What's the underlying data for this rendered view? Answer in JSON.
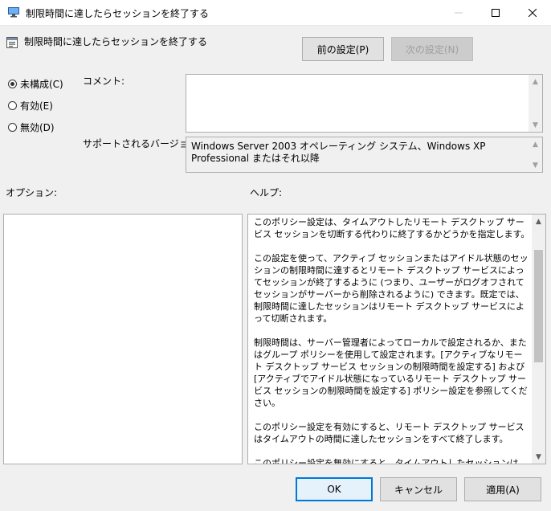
{
  "window": {
    "title": "制限時間に達したらセッションを終了する"
  },
  "header": {
    "policy_title": "制限時間に達したらセッションを終了する",
    "prev_label": "前の設定(P)",
    "next_label": "次の設定(N)"
  },
  "state": {
    "options": [
      {
        "label": "未構成(C)",
        "checked": true
      },
      {
        "label": "有効(E)",
        "checked": false
      },
      {
        "label": "無効(D)",
        "checked": false
      }
    ]
  },
  "comment": {
    "label": "コメント:",
    "value": ""
  },
  "supported": {
    "label": "サポートされるバージョン:",
    "value": "Windows Server 2003 オペレーティング システム、Windows XP Professional またはそれ以降"
  },
  "options_panel": {
    "label": "オプション:"
  },
  "help": {
    "label": "ヘルプ:",
    "paragraphs": [
      "このポリシー設定は、タイムアウトしたリモート デスクトップ サービス セッションを切断する代わりに終了するかどうかを指定します。",
      "この設定を使って、アクティブ セッションまたはアイドル状態のセッションの制限時間に達するとリモート デスクトップ サービスによってセッションが終了するように (つまり、ユーザーがログオフされてセッションがサーバーから削除されるように) できます。既定では、制限時間に達したセッションはリモート デスクトップ サービスによって切断されます。",
      "制限時間は、サーバー管理者によってローカルで設定されるか、またはグループ ポリシーを使用して設定されます。[アクティブなリモート デスクトップ サービス セッションの制限時間を設定する] および [アクティブでアイドル状態になっているリモート デスクトップ サービス セッションの制限時間を設定する] ポリシー設定を参照してください。",
      "このポリシー設定を有効にすると、リモート デスクトップ サービスはタイムアウトの時間に達したセッションをすべて終了します。",
      "このポリシー設定を無効にすると、タイムアウトしたセッションは、サーバー管理者の指定に関係なくリモート デスクトップ サービスによって常に切断されます。"
    ]
  },
  "footer": {
    "ok_label": "OK",
    "cancel_label": "キャンセル",
    "apply_label": "適用(A)"
  }
}
